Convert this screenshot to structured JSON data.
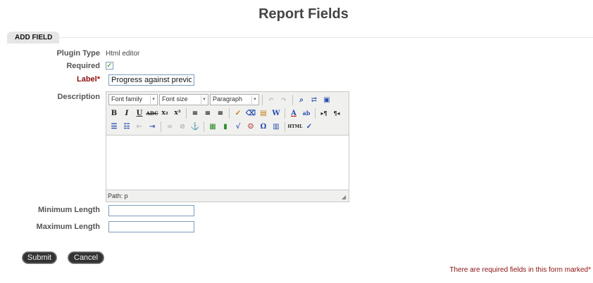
{
  "page": {
    "title": "Report Fields"
  },
  "section": {
    "tab_label": "ADD FIELD"
  },
  "form": {
    "plugin_type_label": "Plugin Type",
    "plugin_type_value": "Html editor",
    "required_label": "Required",
    "required_checked": true,
    "required_check_glyph": "✓",
    "label_label": "Label",
    "required_marker": "*",
    "label_value": "Progress against previou",
    "description_label": "Description",
    "min_length_label": "Minimum Length",
    "min_length_value": "",
    "max_length_label": "Maximum Length",
    "max_length_value": ""
  },
  "editor": {
    "font_family": "Font family",
    "font_size": "Font size",
    "format": "Paragraph",
    "dropdown_arrow": "▾",
    "status_path": "Path: p",
    "content": "",
    "toolbar1_icons": [
      "undo-icon",
      "redo-icon",
      "find-icon",
      "replace-icon",
      "fullscreen-icon"
    ],
    "toolbar2_icons": [
      "bold-icon",
      "italic-icon",
      "underline-icon",
      "strikethrough-icon",
      "subscript-icon",
      "superscript-icon",
      "align-left-icon",
      "align-center-icon",
      "align-right-icon",
      "cleanup-icon",
      "eraser-icon",
      "paste-text-icon",
      "paste-word-icon",
      "forecolor-icon",
      "backcolor-icon",
      "ltr-icon",
      "rtl-icon"
    ],
    "toolbar3_icons": [
      "bullet-list-icon",
      "numbered-list-icon",
      "outdent-icon",
      "indent-icon",
      "link-icon",
      "unlink-icon",
      "anchor-icon",
      "image-icon",
      "media-icon",
      "equation-icon",
      "emoticon-icon",
      "charmap-icon",
      "table-icon",
      "html-source-icon",
      "spellcheck-icon"
    ]
  },
  "buttons": {
    "submit": "Submit",
    "cancel": "Cancel"
  },
  "footer": {
    "required_note": "There are required fields in this form marked",
    "required_marker": "*"
  }
}
